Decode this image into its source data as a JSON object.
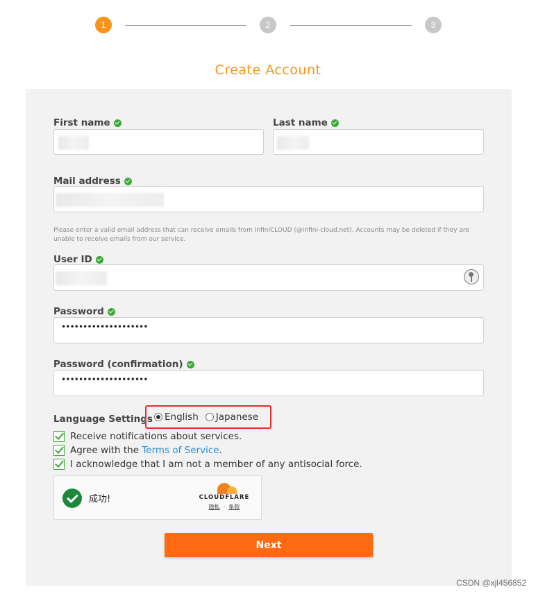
{
  "stepper": {
    "steps": [
      "1",
      "2",
      "3"
    ],
    "active_index": 0
  },
  "page_title": "Create Account",
  "form": {
    "first_name": {
      "label": "First name",
      "value": ""
    },
    "last_name": {
      "label": "Last name",
      "value": ""
    },
    "mail": {
      "label": "Mail address",
      "value": ""
    },
    "mail_hint": "Please enter a valid email address that can receive emails from InfiniCLOUD (@infini-cloud.net). Accounts may be deleted if they are unable to receive emails from our service.",
    "user_id": {
      "label": "User ID",
      "value": ""
    },
    "password": {
      "label": "Password",
      "masked": "••••••••••••••••••••"
    },
    "password_confirm": {
      "label": "Password (confirmation)",
      "masked": "••••••••••••••••••••"
    },
    "language": {
      "label": "Language Settings",
      "options": [
        "English",
        "Japanese"
      ],
      "selected": "English"
    },
    "checkboxes": [
      {
        "text": "Receive notifications about services.",
        "checked": true
      },
      {
        "prefix": "Agree with the ",
        "link": "Terms of Service",
        "suffix": ".",
        "checked": true
      },
      {
        "text": "I acknowledge that I am not a member of any antisocial force.",
        "checked": true
      }
    ],
    "captcha": {
      "status": "成功!",
      "brand": "CLOUDFLARE",
      "links": [
        "隐私",
        "条款"
      ]
    },
    "next_label": "Next"
  },
  "watermark": "CSDN @xjl456852",
  "colors": {
    "accent": "#f7941d",
    "button": "#ff6a13",
    "valid": "#3aaa35",
    "highlight": "#e03030",
    "link": "#2a8fd6"
  }
}
